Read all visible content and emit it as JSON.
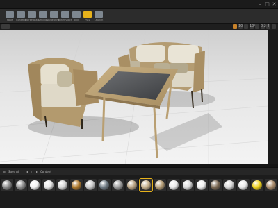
{
  "toolbar": {
    "tools": [
      {
        "id": "save",
        "label": "Save",
        "active": false
      },
      {
        "id": "content",
        "label": "Content",
        "active": false
      },
      {
        "id": "marketplace",
        "label": "Marketplace",
        "active": false
      },
      {
        "id": "settings",
        "label": "Settings",
        "active": false
      },
      {
        "id": "blueprints",
        "label": "Blueprints",
        "active": false
      },
      {
        "id": "cinematics",
        "label": "Cinematics",
        "active": false
      },
      {
        "id": "build",
        "label": "Build",
        "active": false
      },
      {
        "id": "play",
        "label": "Play",
        "active": true
      },
      {
        "id": "launch",
        "label": "Launch",
        "active": false
      }
    ]
  },
  "viewport": {
    "label": "Lit",
    "snap_values": [
      "10",
      "10°",
      "0.25",
      "4"
    ]
  },
  "content_browser": {
    "save_all_label": "Save All",
    "path_label": "Content",
    "materials": [
      {
        "name": "",
        "color": "#8a8a8a"
      },
      {
        "name": "",
        "color": "#8f8f8f"
      },
      {
        "name": "",
        "color": "#f2f2f2"
      },
      {
        "name": "",
        "color": "#e8e8e8"
      },
      {
        "name": "",
        "color": "#d6d6d6"
      },
      {
        "name": "",
        "color": "#b07a2c"
      },
      {
        "name": "",
        "color": "#c9c9c9"
      },
      {
        "name": "",
        "color": "#6f7a83"
      },
      {
        "name": "",
        "color": "#9c9c9c"
      },
      {
        "name": "",
        "color": "#b8a282"
      },
      {
        "name": "",
        "color": "#c6b08c"
      },
      {
        "name": "",
        "color": "#b39b74"
      },
      {
        "name": "",
        "color": "#eaeaea"
      },
      {
        "name": "",
        "color": "#dcdcdc"
      },
      {
        "name": "",
        "color": "#efefef"
      },
      {
        "name": "",
        "color": "#7d6a54"
      },
      {
        "name": "",
        "color": "#d9d9d9"
      },
      {
        "name": "",
        "color": "#e8e8e8"
      },
      {
        "name": "",
        "color": "#f0d21a"
      },
      {
        "name": "",
        "color": "#a88a6a"
      }
    ]
  }
}
